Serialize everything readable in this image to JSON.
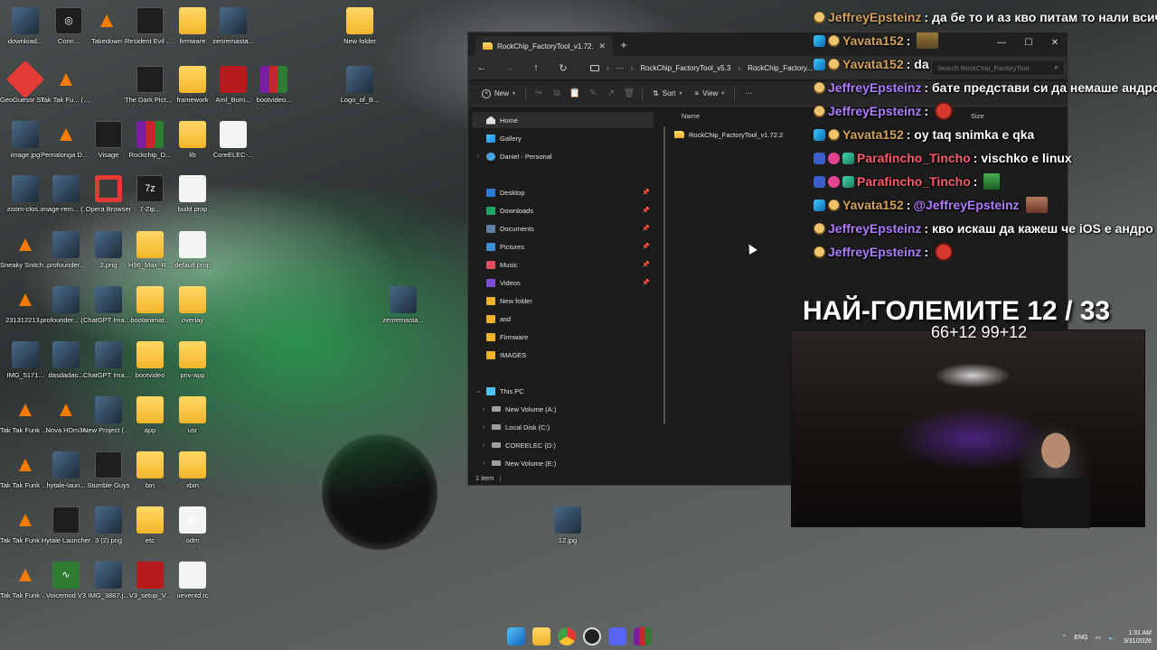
{
  "desktop": {
    "icons": [
      {
        "label": "download...",
        "icon": "image-icon"
      },
      {
        "label": "Conn...",
        "icon": "steering-wheel-icon"
      },
      {
        "label": "Takedown",
        "icon": "vlc-cone-icon"
      },
      {
        "label": "Resident Evil Requiem",
        "icon": "game-icon"
      },
      {
        "label": "firmware",
        "icon": "folder-icon"
      },
      {
        "label": "zenremasta...",
        "icon": "image-icon"
      },
      {
        "label": "New folder",
        "icon": "folder-icon"
      },
      {
        "label": "GeoGuessr Steam E...",
        "icon": "map-pin-icon"
      },
      {
        "label": "Tak Tak Fu... (Slowed ...)",
        "icon": "vlc-cone-icon"
      },
      {
        "label": "The Dark Pictures ...",
        "icon": "game-icon"
      },
      {
        "label": "framework",
        "icon": "folder-icon"
      },
      {
        "label": "Aml_Burn...",
        "icon": "app-icon"
      },
      {
        "label": "bootvideo...",
        "icon": "winrar-icon"
      },
      {
        "label": "Logo_of_B...",
        "icon": "image-icon"
      },
      {
        "label": "image.jpg",
        "icon": "image-icon"
      },
      {
        "label": "Pernalonga Detroit - D...",
        "icon": "vlc-cone-icon"
      },
      {
        "label": "Visage",
        "icon": "game-icon"
      },
      {
        "label": "Rockchip_D...",
        "icon": "winrar-icon"
      },
      {
        "label": "lib",
        "icon": "folder-icon"
      },
      {
        "label": "CoreELEC-...",
        "icon": "file-icon"
      },
      {
        "label": "zoom-clos...",
        "icon": "image-icon"
      },
      {
        "label": "image-rem... (2).png",
        "icon": "image-icon"
      },
      {
        "label": "Opera Browser",
        "icon": "opera-icon"
      },
      {
        "label": "7-Zip...",
        "icon": "archive-icon"
      },
      {
        "label": "build.prop",
        "icon": "file-icon"
      },
      {
        "label": "Sneaky Snitch (Kev...",
        "icon": "vlc-cone-icon"
      },
      {
        "label": "profounder...",
        "icon": "image-icon"
      },
      {
        "label": "2.png",
        "icon": "image-icon"
      },
      {
        "label": "H96_Max_R...",
        "icon": "folder-icon"
      },
      {
        "label": "default.prop",
        "icon": "file-icon"
      },
      {
        "label": "231312213...",
        "icon": "vlc-cone-icon"
      },
      {
        "label": "profounder... (1).webm",
        "icon": "image-icon"
      },
      {
        "label": "ChatGPT Image Feb...",
        "icon": "image-icon"
      },
      {
        "label": "bootanimat...",
        "icon": "folder-icon"
      },
      {
        "label": "overlay",
        "icon": "folder-icon"
      },
      {
        "label": "zenremasta...",
        "icon": "image-icon"
      },
      {
        "label": "IMG_5171...",
        "icon": "image-icon"
      },
      {
        "label": "dasdadas...",
        "icon": "image-icon"
      },
      {
        "label": "ChatGPT Image Feb...",
        "icon": "image-icon"
      },
      {
        "label": "bootvideo",
        "icon": "folder-icon"
      },
      {
        "label": "priv-app",
        "icon": "folder-icon"
      },
      {
        "label": "Tak Tak Funk Chipdag...",
        "icon": "vlc-cone-icon"
      },
      {
        "label": "Nova HDm3u",
        "icon": "vlc-cone-icon"
      },
      {
        "label": "New Project (25).png",
        "icon": "image-icon"
      },
      {
        "label": "app",
        "icon": "folder-icon"
      },
      {
        "label": "usr",
        "icon": "folder-icon"
      },
      {
        "label": "Tak Tak Funk (Slowed +...)",
        "icon": "vlc-cone-icon"
      },
      {
        "label": "hytale-laun...",
        "icon": "image-icon"
      },
      {
        "label": "Stumble Guys",
        "icon": "game-icon"
      },
      {
        "label": "bin",
        "icon": "folder-icon"
      },
      {
        "label": "xbin",
        "icon": "folder-icon"
      },
      {
        "label": "Tak Tak Funk (Slowed +...)",
        "icon": "vlc-cone-icon"
      },
      {
        "label": "Hytale Launcher",
        "icon": "game-icon"
      },
      {
        "label": "3 (2).png",
        "icon": "image-icon"
      },
      {
        "label": "etc",
        "icon": "folder-icon"
      },
      {
        "label": "odm",
        "icon": "settings-file-icon"
      },
      {
        "label": "Tak Tak Funk (Slowed +...)",
        "icon": "vlc-cone-icon"
      },
      {
        "label": "Voicemod V3",
        "icon": "voicemod-icon"
      },
      {
        "label": "IMG_3887.j...",
        "icon": "image-icon"
      },
      {
        "label": "V3_setup_V...",
        "icon": "app-icon"
      },
      {
        "label": "ueventd.rc",
        "icon": "file-icon"
      },
      {
        "label": "12.jpg",
        "icon": "image-icon"
      }
    ]
  },
  "explorer": {
    "tab_title": "RockChip_FactoryTool_v1.72.2",
    "new_tab": "+",
    "breadcrumb": [
      "RockChip_FactoryTool_v5.3",
      "RockChip_Factory..."
    ],
    "search_placeholder": "Search RockChip_FactoryTool",
    "toolbar": {
      "new": "New",
      "sort": "Sort",
      "view": "View",
      "more": "···"
    },
    "nav": {
      "home": "Home",
      "gallery": "Gallery",
      "personal": "Daniel - Personal",
      "quick": [
        "Desktop",
        "Downloads",
        "Documents",
        "Pictures",
        "Music",
        "Videos",
        "New folder",
        "asd",
        "Firmware",
        "IMAGES"
      ],
      "this_pc": "This PC",
      "drives": [
        "New Volume (A:)",
        "Local Disk (C:)",
        "COREELEC (D:)",
        "New Volume (E:)"
      ]
    },
    "columns": {
      "name": "Name",
      "size": "Size"
    },
    "items": [
      {
        "name": "RockChip_FactoryTool_v1.72.2"
      }
    ],
    "status": "1 item"
  },
  "chat": [
    {
      "user": "JeffreyEpsteinz",
      "color": "gold",
      "message": ": да бе то и аз кво питам то нали всич"
    },
    {
      "user": "Yavata152",
      "color": "gold",
      "message": ":"
    },
    {
      "user": "Yavata152",
      "color": "gold",
      "message": ": da"
    },
    {
      "user": "JeffreyEpsteinz",
      "color": "purple",
      "message": ": бате представи си да немаше андро"
    },
    {
      "user": "JeffreyEpsteinz",
      "color": "purple",
      "message": ":"
    },
    {
      "user": "Yavata152",
      "color": "gold",
      "message": ": oy taq snimka e qka"
    },
    {
      "user": "Parafincho_Tincho",
      "color": "red",
      "message": ": vischko e linux"
    },
    {
      "user": "Parafincho_Tincho",
      "color": "red",
      "message": ":"
    },
    {
      "user": "Yavata152",
      "color": "gold",
      "message": ":",
      "mention": "@JeffreyEpsteinz"
    },
    {
      "user": "JeffreyEpsteinz",
      "color": "purple",
      "message": ": кво искаш да кажеш че iOS е андро"
    },
    {
      "user": "JeffreyEpsteinz",
      "color": "purple",
      "message": ":"
    }
  ],
  "overlay": {
    "title": "НАЙ-ГОЛЕМИТЕ 12 / 33",
    "subtitle": "66+12 99+12"
  },
  "tray": {
    "lang": "ENG",
    "time": "1:31 AM",
    "date": "3/31/2026"
  }
}
